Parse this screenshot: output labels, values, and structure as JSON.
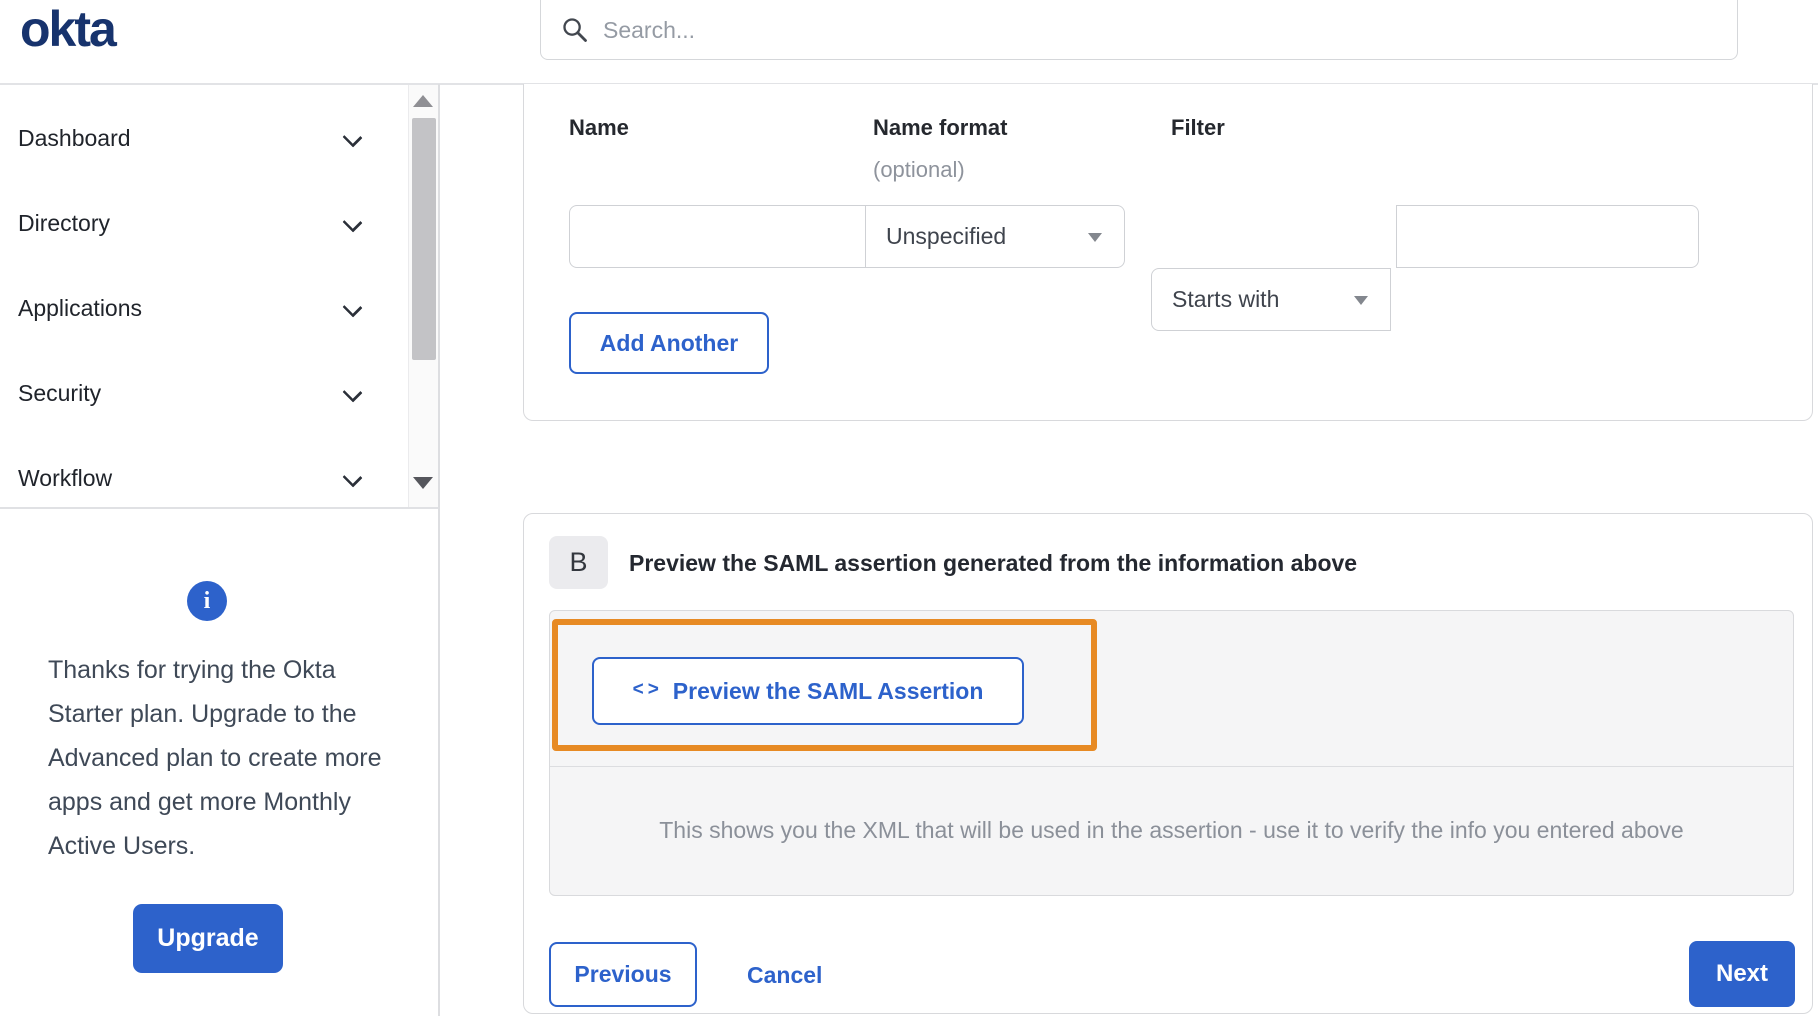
{
  "header": {
    "logo": "okta",
    "search": {
      "placeholder": "Search..."
    }
  },
  "sidebar": {
    "nav_items": [
      {
        "label": "Dashboard"
      },
      {
        "label": "Directory"
      },
      {
        "label": "Applications"
      },
      {
        "label": "Security"
      },
      {
        "label": "Workflow"
      }
    ],
    "promo": {
      "text": "Thanks for trying the Okta Starter plan. Upgrade to the Advanced plan to create more apps and get more Monthly Active Users.",
      "upgrade_label": "Upgrade"
    }
  },
  "main": {
    "attribute_form": {
      "name_label": "Name",
      "name_format_label": "Name format",
      "name_format_sub": "(optional)",
      "filter_label": "Filter",
      "name_value": "",
      "name_format_value": "Unspecified",
      "filter_operator_value": "Starts with",
      "filter_value": "",
      "add_another_label": "Add Another"
    },
    "section_b": {
      "badge": "B",
      "heading": "Preview the SAML assertion generated from the information above",
      "code_icon_glyph": "<>",
      "preview_button_label": "Preview the SAML Assertion",
      "description": "This shows you the XML that will be used in the assertion - use it to verify the info you entered above"
    },
    "footer": {
      "previous_label": "Previous",
      "cancel_label": "Cancel",
      "next_label": "Next"
    }
  },
  "colors": {
    "accent_blue": "#2d62cb",
    "logo_navy": "#17336d",
    "highlight_orange": "#e78a24",
    "panel_gray": "#f5f5f6"
  }
}
